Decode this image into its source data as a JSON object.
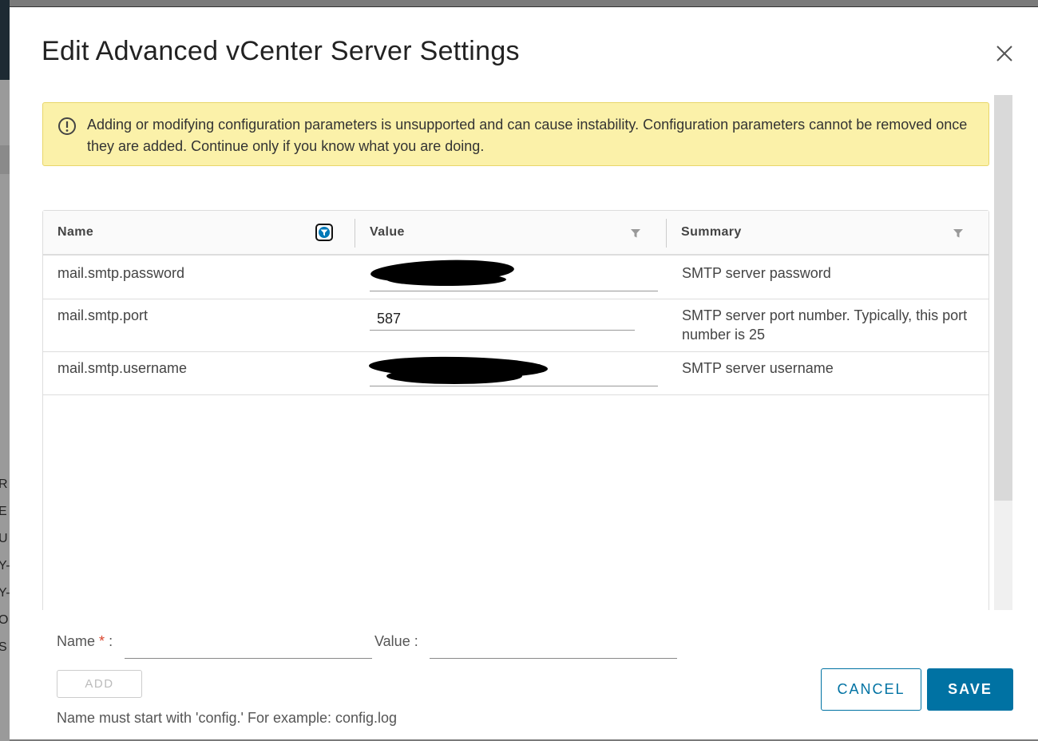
{
  "background": {
    "letters": [
      "R",
      "E",
      "U",
      "Y-",
      "Y-",
      "O",
      "S"
    ]
  },
  "dialog": {
    "title": "Edit Advanced vCenter Server Settings",
    "close_icon": "close-icon"
  },
  "alert": {
    "icon": "exclamation-circle-icon",
    "text": "Adding or modifying configuration parameters is unsupported and can cause instability. Configuration parameters cannot be removed once they are added. Continue only if you know what you are doing.",
    "background_color": "#fbf1a9"
  },
  "grid": {
    "columns": [
      {
        "label": "Name",
        "filter_active": true
      },
      {
        "label": "Value",
        "filter_active": false
      },
      {
        "label": "Summary",
        "filter_active": false
      }
    ],
    "rows": [
      {
        "name": "mail.smtp.password",
        "value": "",
        "value_redacted": true,
        "summary": "SMTP server password"
      },
      {
        "name": "mail.smtp.port",
        "value": "587",
        "value_redacted": false,
        "summary": "SMTP server port number. Typically, this port number is 25"
      },
      {
        "name": "mail.smtp.username",
        "value": "",
        "value_redacted": true,
        "summary": "SMTP server username"
      }
    ]
  },
  "form": {
    "name_label": "Name",
    "required_mark": "*",
    "colon": ":",
    "value_label": "Value :",
    "name_value": "",
    "value_value": "",
    "add_label": "ADD",
    "hint": "Name must start with 'config.' For example: config.log"
  },
  "actions": {
    "cancel_label": "CANCEL",
    "save_label": "SAVE",
    "primary_color": "#0072a3"
  }
}
